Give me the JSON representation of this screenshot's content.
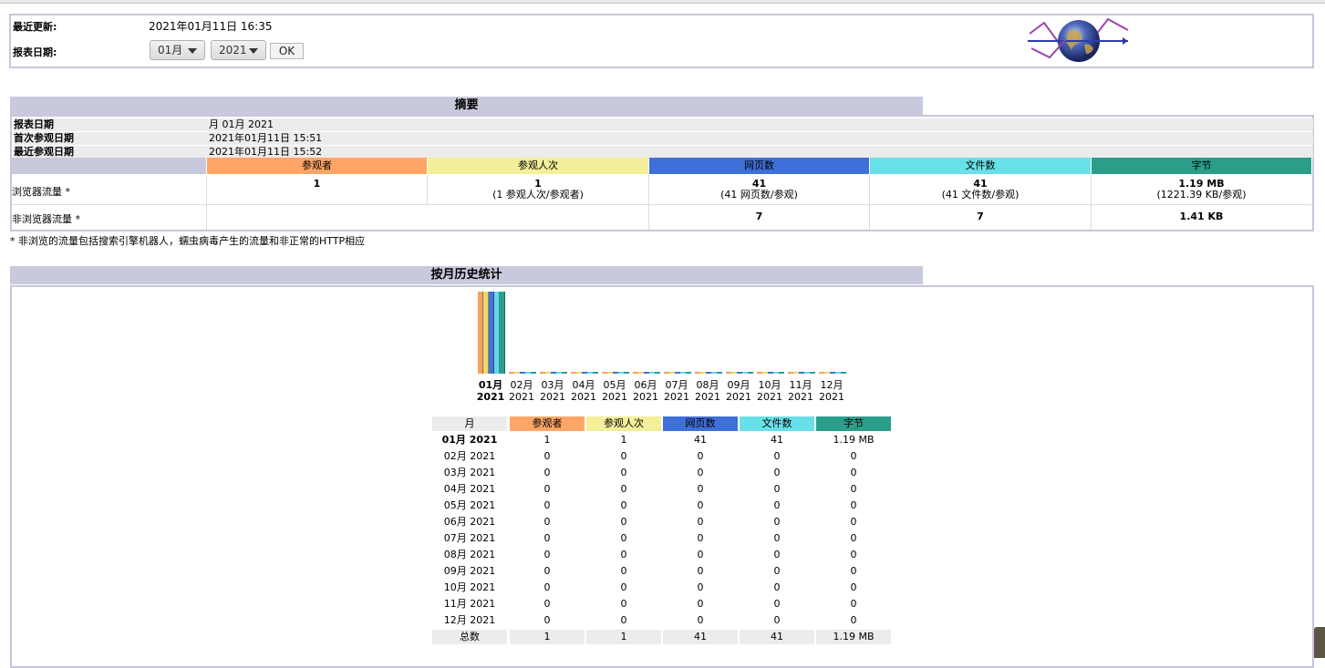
{
  "header": {
    "last_update_label": "最近更新:",
    "last_update_value": "2021年01月11日 16:35",
    "report_date_label": "报表日期:",
    "month_select": "01月",
    "year_select": "2021",
    "ok_label": "OK"
  },
  "summary": {
    "title": "摘要",
    "report_date_label": "报表日期",
    "report_date_value": "月 01月 2021",
    "first_visit_label": "首次参观日期",
    "first_visit_value": "2021年01月11日 15:51",
    "last_visit_label": "最近参观日期",
    "last_visit_value": "2021年01月11日 15:52",
    "columns": [
      "参观者",
      "参观人次",
      "网页数",
      "文件数",
      "字节"
    ],
    "browser_label": "浏览器流量 *",
    "browser_visitors": "1",
    "browser_visits": "1",
    "browser_visits_sub": "(1 参观人次/参观者)",
    "browser_pages": "41",
    "browser_pages_sub": "(41 网页数/参观)",
    "browser_files": "41",
    "browser_files_sub": "(41 文件数/参观)",
    "browser_bytes": "1.19 MB",
    "browser_bytes_sub": "(1221.39 KB/参观)",
    "nonbrowser_label": "非浏览器流量 *",
    "nonbrowser_pages": "7",
    "nonbrowser_files": "7",
    "nonbrowser_bytes": "1.41 KB",
    "note": "* 非浏览的流量包括搜索引擎机器人，蠕虫病毒产生的流量和非正常的HTTP相应"
  },
  "history": {
    "title": "按月历史统计",
    "col_month": "月",
    "columns": [
      "参观者",
      "参观人次",
      "网页数",
      "文件数",
      "字节"
    ],
    "total_label": "总数",
    "totals": [
      "1",
      "1",
      "41",
      "41",
      "1.19 MB"
    ]
  },
  "chart_data": {
    "type": "bar",
    "categories": [
      "01月 2021",
      "02月 2021",
      "03月 2021",
      "04月 2021",
      "05月 2021",
      "06月 2021",
      "07月 2021",
      "08月 2021",
      "09月 2021",
      "10月 2021",
      "11月 2021",
      "12月 2021"
    ],
    "axis_labels": [
      {
        "m": "01月",
        "y": "2021"
      },
      {
        "m": "02月",
        "y": "2021"
      },
      {
        "m": "03月",
        "y": "2021"
      },
      {
        "m": "04月",
        "y": "2021"
      },
      {
        "m": "05月",
        "y": "2021"
      },
      {
        "m": "06月",
        "y": "2021"
      },
      {
        "m": "07月",
        "y": "2021"
      },
      {
        "m": "08月",
        "y": "2021"
      },
      {
        "m": "09月",
        "y": "2021"
      },
      {
        "m": "10月",
        "y": "2021"
      },
      {
        "m": "11月",
        "y": "2021"
      },
      {
        "m": "12月",
        "y": "2021"
      }
    ],
    "series": [
      {
        "name": "参观者",
        "color": "#f4a261",
        "values": [
          1,
          0,
          0,
          0,
          0,
          0,
          0,
          0,
          0,
          0,
          0,
          0
        ]
      },
      {
        "name": "参观人次",
        "color": "#e9d96b",
        "values": [
          1,
          0,
          0,
          0,
          0,
          0,
          0,
          0,
          0,
          0,
          0,
          0
        ]
      },
      {
        "name": "网页数",
        "color": "#4472d8",
        "values": [
          41,
          0,
          0,
          0,
          0,
          0,
          0,
          0,
          0,
          0,
          0,
          0
        ]
      },
      {
        "name": "文件数",
        "color": "#62d9e6",
        "values": [
          41,
          0,
          0,
          0,
          0,
          0,
          0,
          0,
          0,
          0,
          0,
          0
        ]
      },
      {
        "name": "字节",
        "color": "#2aa08a",
        "values": [
          "1.19 MB",
          "0",
          "0",
          "0",
          "0",
          "0",
          "0",
          "0",
          "0",
          "0",
          "0",
          "0"
        ]
      }
    ],
    "rows": [
      [
        "01月 2021",
        "1",
        "1",
        "41",
        "41",
        "1.19 MB"
      ],
      [
        "02月 2021",
        "0",
        "0",
        "0",
        "0",
        "0"
      ],
      [
        "03月 2021",
        "0",
        "0",
        "0",
        "0",
        "0"
      ],
      [
        "04月 2021",
        "0",
        "0",
        "0",
        "0",
        "0"
      ],
      [
        "05月 2021",
        "0",
        "0",
        "0",
        "0",
        "0"
      ],
      [
        "06月 2021",
        "0",
        "0",
        "0",
        "0",
        "0"
      ],
      [
        "07月 2021",
        "0",
        "0",
        "0",
        "0",
        "0"
      ],
      [
        "08月 2021",
        "0",
        "0",
        "0",
        "0",
        "0"
      ],
      [
        "09月 2021",
        "0",
        "0",
        "0",
        "0",
        "0"
      ],
      [
        "10月 2021",
        "0",
        "0",
        "0",
        "0",
        "0"
      ],
      [
        "11月 2021",
        "0",
        "0",
        "0",
        "0",
        "0"
      ],
      [
        "12月 2021",
        "0",
        "0",
        "0",
        "0",
        "0"
      ]
    ]
  },
  "colors": {
    "visitors": "#ffa566",
    "visits": "#f3ef9a",
    "pages": "#3f6fd8",
    "files": "#68e0e8",
    "bytes": "#2a9e8a",
    "title_bar": "#c9c9dd",
    "row_gray": "#ececec"
  }
}
